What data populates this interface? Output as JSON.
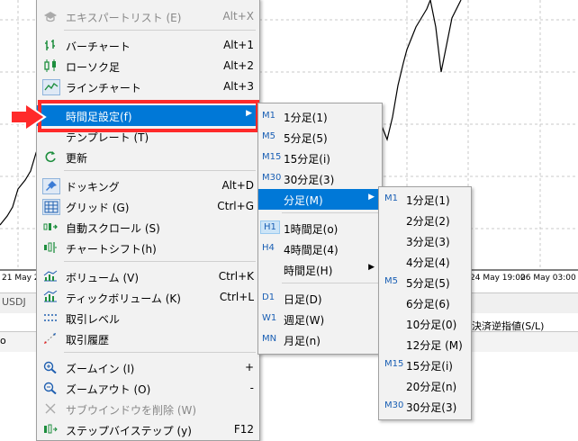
{
  "chart": {
    "x_labels": [
      "21 May 2",
      "24 May 19:00",
      "26 May 03:00"
    ],
    "tab_label": "USDJ",
    "bottom_column": "決済逆指値(S/L)",
    "bottom_left": "o"
  },
  "main_menu": {
    "items": [
      {
        "label": "エキスパートリスト (E)",
        "shortcut": "Alt+X",
        "icon": "expert-list-icon",
        "disabled": true
      },
      {
        "label": "バーチャート",
        "shortcut": "Alt+1",
        "icon": "bar-chart-icon"
      },
      {
        "label": "ローソク足",
        "shortcut": "Alt+2",
        "icon": "candlestick-icon"
      },
      {
        "label": "ラインチャート",
        "shortcut": "Alt+3",
        "icon": "line-chart-icon"
      },
      {
        "label": "時間足設定(f)",
        "shortcut": "",
        "icon": "red-arrow-icon"
      },
      {
        "label": "テンプレート (T)",
        "shortcut": "",
        "icon": ""
      },
      {
        "label": "更新",
        "shortcut": "",
        "icon": "refresh-icon"
      },
      {
        "label": "ドッキング",
        "shortcut": "Alt+D",
        "icon": "pin-icon"
      },
      {
        "label": "グリッド (G)",
        "shortcut": "Ctrl+G",
        "icon": "grid-icon"
      },
      {
        "label": "自動スクロール (S)",
        "shortcut": "",
        "icon": "auto-scroll-icon"
      },
      {
        "label": "チャートシフト(h)",
        "shortcut": "",
        "icon": "chart-shift-icon"
      },
      {
        "label": "ボリューム (V)",
        "shortcut": "Ctrl+K",
        "icon": "volume-icon"
      },
      {
        "label": "ティックボリューム (K)",
        "shortcut": "Ctrl+L",
        "icon": "tick-volume-icon"
      },
      {
        "label": "取引レベル",
        "shortcut": "",
        "icon": "trade-levels-icon"
      },
      {
        "label": "取引履歴",
        "shortcut": "",
        "icon": "trade-history-icon"
      },
      {
        "label": "ズームイン (I)",
        "shortcut": "+",
        "icon": "zoom-in-icon"
      },
      {
        "label": "ズームアウト (O)",
        "shortcut": "-",
        "icon": "zoom-out-icon"
      },
      {
        "label": "サブウインドウを削除 (W)",
        "shortcut": "",
        "icon": "close-icon",
        "disabled": true
      },
      {
        "label": "ステップバイステップ (y)",
        "shortcut": "F12",
        "icon": "step-icon"
      }
    ]
  },
  "timeframe_menu": {
    "items": [
      {
        "code": "M1",
        "label": "1分足(1)"
      },
      {
        "code": "M5",
        "label": "5分足(5)"
      },
      {
        "code": "M15",
        "label": "15分足(i)"
      },
      {
        "code": "M30",
        "label": "30分足(3)"
      },
      {
        "code": "",
        "label": "分足(M)"
      },
      {
        "code": "H1",
        "label": "1時間足(o)"
      },
      {
        "code": "H4",
        "label": "4時間足(4)"
      },
      {
        "code": "",
        "label": "時間足(H)"
      },
      {
        "code": "D1",
        "label": "日足(D)"
      },
      {
        "code": "W1",
        "label": "週足(W)"
      },
      {
        "code": "MN",
        "label": "月足(n)"
      }
    ]
  },
  "minute_menu": {
    "items": [
      {
        "code": "M1",
        "label": "1分足(1)"
      },
      {
        "code": "",
        "label": "2分足(2)"
      },
      {
        "code": "",
        "label": "3分足(3)"
      },
      {
        "code": "",
        "label": "4分足(4)"
      },
      {
        "code": "M5",
        "label": "5分足(5)"
      },
      {
        "code": "",
        "label": "6分足(6)"
      },
      {
        "code": "",
        "label": "10分足(0)"
      },
      {
        "code": "",
        "label": "12分足 (M)"
      },
      {
        "code": "M15",
        "label": "15分足(i)"
      },
      {
        "code": "",
        "label": "20分足(n)"
      },
      {
        "code": "M30",
        "label": "30分足(3)"
      }
    ]
  },
  "colors": {
    "highlight": "#0078d7",
    "annotation": "#ff2a2a",
    "code": "#1a5fb4"
  }
}
